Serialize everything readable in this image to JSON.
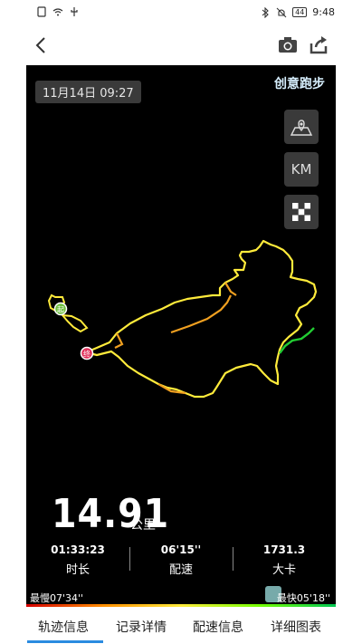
{
  "status": {
    "battery": "44",
    "time": "9:48"
  },
  "map": {
    "date": "11月14日 09:27",
    "mode": "创意跑步",
    "km_label": "KM"
  },
  "summary": {
    "distance": "14.91",
    "unit": "公里",
    "stats": [
      {
        "value": "01:33:23",
        "label": "时长"
      },
      {
        "value": "06'15''",
        "label": "配速"
      },
      {
        "value": "1731.3",
        "label": "大卡"
      }
    ],
    "slowest": "最慢07'34''",
    "fastest": "最快05'18''"
  },
  "tabs": [
    "轨迹信息",
    "记录详情",
    "配速信息",
    "详细图表"
  ],
  "markers": {
    "start": "起",
    "end": "终"
  },
  "colors": {
    "accent": "#2b8be0",
    "route_yellow": "#ffeb3b",
    "route_orange": "#f0a020",
    "route_green": "#22cc33"
  }
}
